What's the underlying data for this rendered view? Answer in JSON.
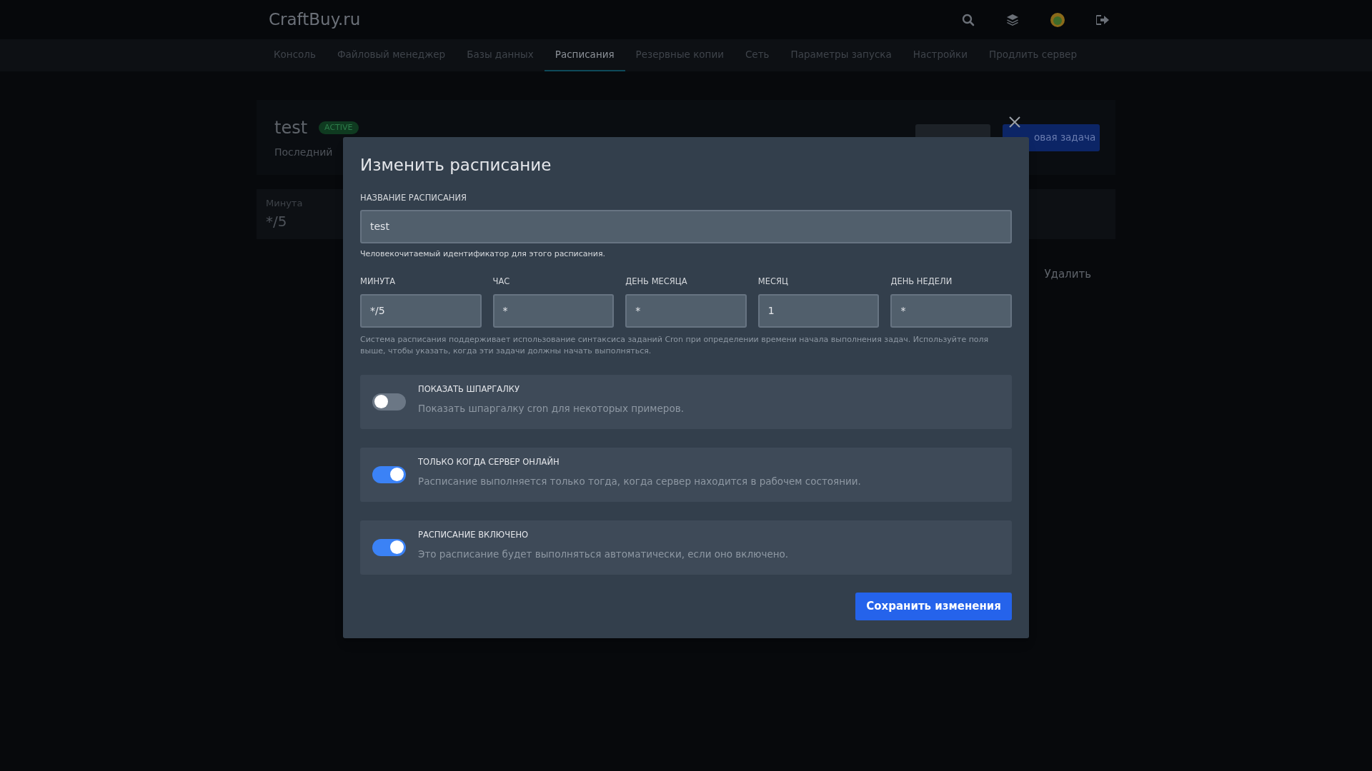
{
  "header": {
    "logo": "CraftBuy.ru"
  },
  "nav": [
    {
      "label": "Консоль",
      "selected": false
    },
    {
      "label": "Файловый менеджер",
      "selected": false
    },
    {
      "label": "Базы данных",
      "selected": false
    },
    {
      "label": "Расписания",
      "selected": true
    },
    {
      "label": "Резервные копии",
      "selected": false
    },
    {
      "label": "Сеть",
      "selected": false
    },
    {
      "label": "Параметры запуска",
      "selected": false
    },
    {
      "label": "Настройки",
      "selected": false
    },
    {
      "label": "Продлить сервер",
      "selected": false
    }
  ],
  "schedule": {
    "name": "test",
    "badge": "ACTIVE",
    "subtitle": "Последний",
    "new_task_button": "овая задача",
    "cron_label": "Минута",
    "cron_value": "*/5",
    "delete": "Удалить"
  },
  "modal": {
    "title": "Изменить расписание",
    "name_field": {
      "label": "НАЗВАНИЕ РАСПИСАНИЯ",
      "value": "test",
      "hint": "Человекочитаемый идентификатор для этого расписания."
    },
    "cron_fields": [
      {
        "label": "МИНУТА",
        "value": "*/5"
      },
      {
        "label": "ЧАС",
        "value": "*"
      },
      {
        "label": "ДЕНЬ МЕСЯЦА",
        "value": "*"
      },
      {
        "label": "МЕСЯЦ",
        "value": "1"
      },
      {
        "label": "ДЕНЬ НЕДЕЛИ",
        "value": "*"
      }
    ],
    "cron_help": "Система расписания поддерживает использование синтаксиса заданий Cron при определении времени начала выполнения задач. Используйте поля выше, чтобы указать, когда эти задачи должны начать выполняться.",
    "toggles": [
      {
        "title": "ПОКАЗАТЬ ШПАРГАЛКУ",
        "description": "Показать шпаргалку cron для некоторых примеров.",
        "on": false
      },
      {
        "title": "ТОЛЬКО КОГДА СЕРВЕР ОНЛАЙН",
        "description": "Расписание выполняется только тогда, когда сервер находится в рабочем состоянии.",
        "on": true
      },
      {
        "title": "РАСПИСАНИЕ ВКЛЮЧЕНО",
        "description": "Это расписание будет выполняться автоматически, если оно включено.",
        "on": true
      }
    ],
    "save_button": "Сохранить изменения"
  }
}
